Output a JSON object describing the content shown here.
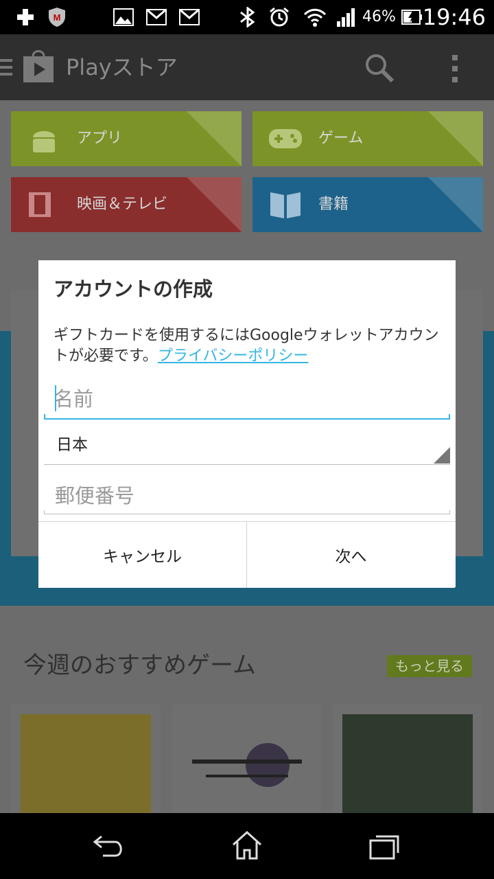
{
  "status_bar": {
    "battery_percent": "46%",
    "time": "19:46",
    "icons": [
      "hospital-plus-icon",
      "mcafee-icon",
      "image-icon",
      "gmail-icon",
      "gmail-icon",
      "bluetooth-icon",
      "alarm-icon",
      "wifi-icon",
      "signal-icon",
      "battery-charging-icon"
    ]
  },
  "action_bar": {
    "title": "Playストア"
  },
  "categories": [
    {
      "label": "アプリ",
      "color": "#7c9427"
    },
    {
      "label": "ゲーム",
      "color": "#7c9427"
    },
    {
      "label": "映画＆テレビ",
      "color": "#8a2d2d"
    },
    {
      "label": "書籍",
      "color": "#1d628a"
    }
  ],
  "sections": {
    "weekly_games_title": "今週のおすすめゲーム",
    "more_label": "もっと見る"
  },
  "dialog": {
    "title": "アカウントの作成",
    "message": "ギフトカードを使用するにはGoogleウォレットアカウントが必要です。",
    "privacy_link": "プライバシーポリシー",
    "name_placeholder": "名前",
    "country_value": "日本",
    "postal_placeholder": "郵便番号",
    "cancel_label": "キャンセル",
    "next_label": "次へ"
  },
  "colors": {
    "accent": "#33b5e5"
  }
}
